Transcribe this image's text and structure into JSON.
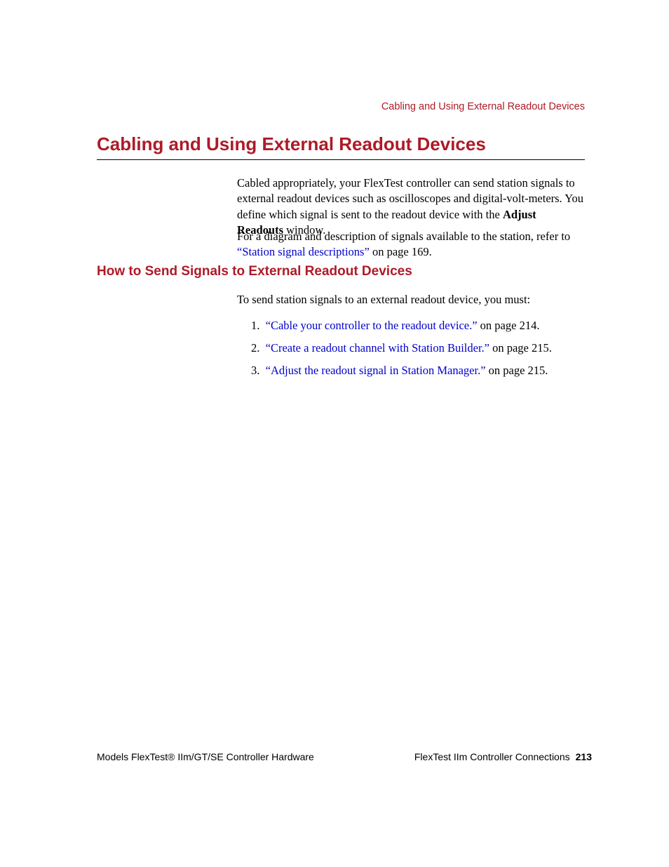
{
  "header": {
    "running": "Cabling and Using External Readout Devices"
  },
  "headings": {
    "h1": "Cabling and Using External Readout Devices",
    "h2": "How to Send Signals to External Readout Devices"
  },
  "paragraphs": {
    "p1a": "Cabled appropriately, your FlexTest controller can send station signals to external readout devices such as oscilloscopes and digital-volt-meters. You define which signal is sent to the readout device with the ",
    "p1_bold": "Adjust Readouts",
    "p1b": " window.",
    "p2a": "For a diagram and description of signals available to the station, refer to ",
    "p2_link": "“Station signal descriptions”",
    "p2b": " on page 169.",
    "p3": "To send station signals to an external readout device, you must:"
  },
  "list": [
    {
      "num": "1.",
      "link": "“Cable your controller to the readout device.”",
      "suffix": " on page 214."
    },
    {
      "num": "2.",
      "link": "“Create a readout channel with Station Builder.”",
      "suffix": " on page 215."
    },
    {
      "num": "3.",
      "link": "“Adjust the readout signal in Station Manager.”",
      "suffix": " on page 215."
    }
  ],
  "footer": {
    "left": "Models FlexTest® IIm/GT/SE Controller Hardware",
    "right": "FlexTest IIm Controller Connections",
    "page": "213"
  }
}
